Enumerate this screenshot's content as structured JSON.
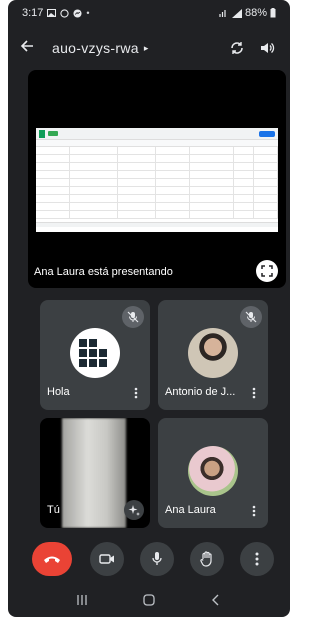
{
  "status_bar": {
    "time": "3:17",
    "battery": "88%"
  },
  "header": {
    "meeting_code": "auo-vzys-rwa",
    "caret": "▸"
  },
  "presentation": {
    "presenter_label": "Ana Laura está presentando"
  },
  "participants": [
    {
      "name": "Hola",
      "muted": true
    },
    {
      "name": "Antonio de J...",
      "muted": true
    },
    {
      "name": "Tú",
      "muted": false
    },
    {
      "name": "Ana Laura",
      "muted": false
    }
  ],
  "colors": {
    "background": "#202124",
    "tile": "#3c4043",
    "end_call": "#ea4335"
  }
}
